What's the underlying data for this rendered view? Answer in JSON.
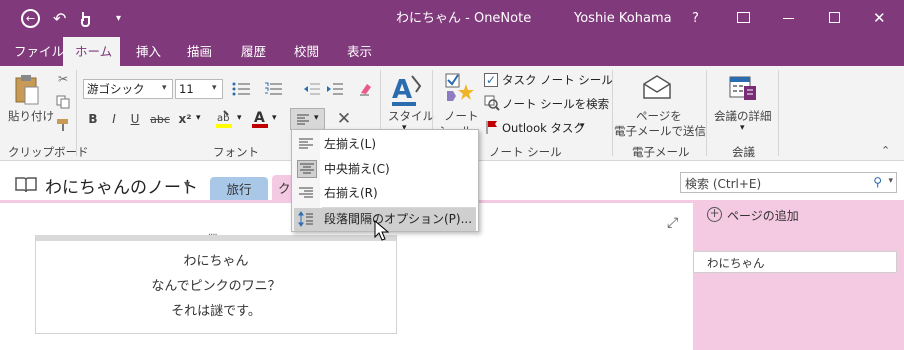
{
  "window": {
    "title": "わにちゃん - OneNote",
    "user": "Yoshie Kohama",
    "help": "?"
  },
  "tabs": [
    {
      "label": "ファイル"
    },
    {
      "label": "ホーム"
    },
    {
      "label": "挿入"
    },
    {
      "label": "描画"
    },
    {
      "label": "履歴"
    },
    {
      "label": "校閲"
    },
    {
      "label": "表示"
    }
  ],
  "ribbon": {
    "clipboard": {
      "paste_label": "貼り付け",
      "group_label": "クリップボード"
    },
    "font": {
      "font_name": "游ゴシック",
      "font_size": "11",
      "group_label": "フォント",
      "bold": "B",
      "italic": "I",
      "underline": "U",
      "strike": "abc",
      "superscript": "x²",
      "font_color_glyph": "A",
      "clear_glyph": "✕"
    },
    "styles": {
      "label": "スタイル"
    },
    "tags": {
      "note_tag_line1": "ノート",
      "note_tag_line2": "シール",
      "todo_tag": "タスク ノート シール",
      "find_tags": "ノート シールを検索",
      "outlook_tasks": "Outlook タスク",
      "group_label": "ノート シール"
    },
    "email": {
      "line1": "ページを",
      "line2": "電子メールで送信",
      "group_label": "電子メール"
    },
    "meetings": {
      "label": "会議の詳細",
      "group_label": "会議"
    }
  },
  "align_menu": {
    "items": [
      {
        "label": "左揃え(L)",
        "icon": "align-left-icon"
      },
      {
        "label": "中央揃え(C)",
        "icon": "align-center-icon"
      },
      {
        "label": "右揃え(R)",
        "icon": "align-right-icon"
      },
      {
        "label": "段落間隔のオプション(P)...",
        "icon": "paragraph-spacing-icon"
      }
    ]
  },
  "notebook": {
    "name": "わにちゃんのノート",
    "sections": [
      {
        "label": "旅行"
      },
      {
        "label": "ク"
      }
    ]
  },
  "search": {
    "placeholder": "検索 (Ctrl+E)"
  },
  "pages": {
    "add_label": "ページの追加",
    "items": [
      {
        "label": "わにちゃん"
      }
    ]
  },
  "note": {
    "lines": [
      "わにちゃん",
      "なんでピンクのワニ？",
      "それは謎です。"
    ]
  },
  "colors": {
    "accent": "#80397b",
    "page_list": "#f4c9e2",
    "section_travel": "#a9c8e8",
    "section_active": "#f4c9e2"
  }
}
